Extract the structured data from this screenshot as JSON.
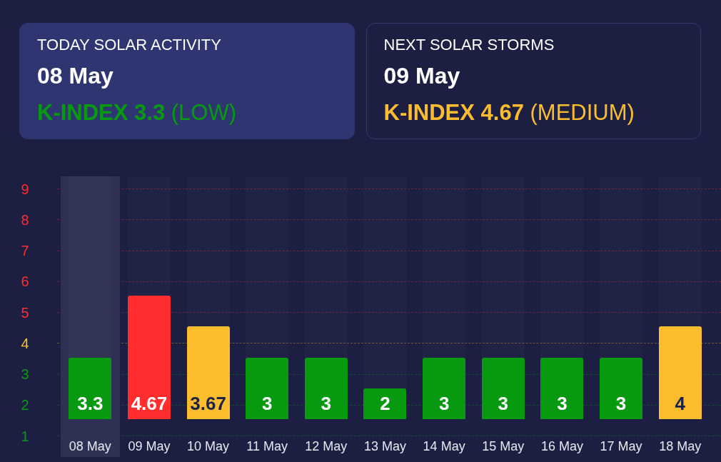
{
  "cards": [
    {
      "title": "TODAY SOLAR ACTIVITY",
      "date": "08 May",
      "index": "**K-INDEX 3.3** (LOW)",
      "color": "#079a10",
      "selected": true
    },
    {
      "title": "NEXT SOLAR STORMS",
      "date": "09 May",
      "index": "**K-INDEX 4.67** (MEDIUM)",
      "color": "#fbbd2d",
      "selected": false
    }
  ],
  "y_axis": [
    {
      "label": "9",
      "color": "#ff2d2d"
    },
    {
      "label": "8",
      "color": "#ff2d2d"
    },
    {
      "label": "7",
      "color": "#ff2d2d"
    },
    {
      "label": "6",
      "color": "#ff2d2d"
    },
    {
      "label": "5",
      "color": "#ff2d2d"
    },
    {
      "label": "4",
      "color": "#fbbd2d"
    },
    {
      "label": "3",
      "color": "#079a10"
    },
    {
      "label": "2",
      "color": "#079a10"
    },
    {
      "label": "1",
      "color": "#079a10"
    }
  ],
  "days": [
    {
      "date": "08 May",
      "value": "3.3",
      "level": 0.254,
      "color": "#079a10",
      "selected": true
    },
    {
      "date": "09 May",
      "value": "4.67",
      "level": 0.509,
      "color": "#ff2d2d",
      "selected": false
    },
    {
      "date": "10 May",
      "value": "3.67",
      "level": 0.382,
      "color": "#fbbd2d",
      "selected": false
    },
    {
      "date": "11 May",
      "value": "3",
      "level": 0.254,
      "color": "#079a10",
      "selected": false
    },
    {
      "date": "12 May",
      "value": "3",
      "level": 0.254,
      "color": "#079a10",
      "selected": false
    },
    {
      "date": "13 May",
      "value": "2",
      "level": 0.127,
      "color": "#079a10",
      "selected": false
    },
    {
      "date": "14 May",
      "value": "3",
      "level": 0.254,
      "color": "#079a10",
      "selected": false
    },
    {
      "date": "15 May",
      "value": "3",
      "level": 0.254,
      "color": "#079a10",
      "selected": false
    },
    {
      "date": "16 May",
      "value": "3",
      "level": 0.254,
      "color": "#079a10",
      "selected": false
    },
    {
      "date": "17 May",
      "value": "3",
      "level": 0.254,
      "color": "#079a10",
      "selected": false
    },
    {
      "date": "18 May",
      "value": "4",
      "level": 0.382,
      "color": "#fbbd2d",
      "selected": false
    }
  ]
}
